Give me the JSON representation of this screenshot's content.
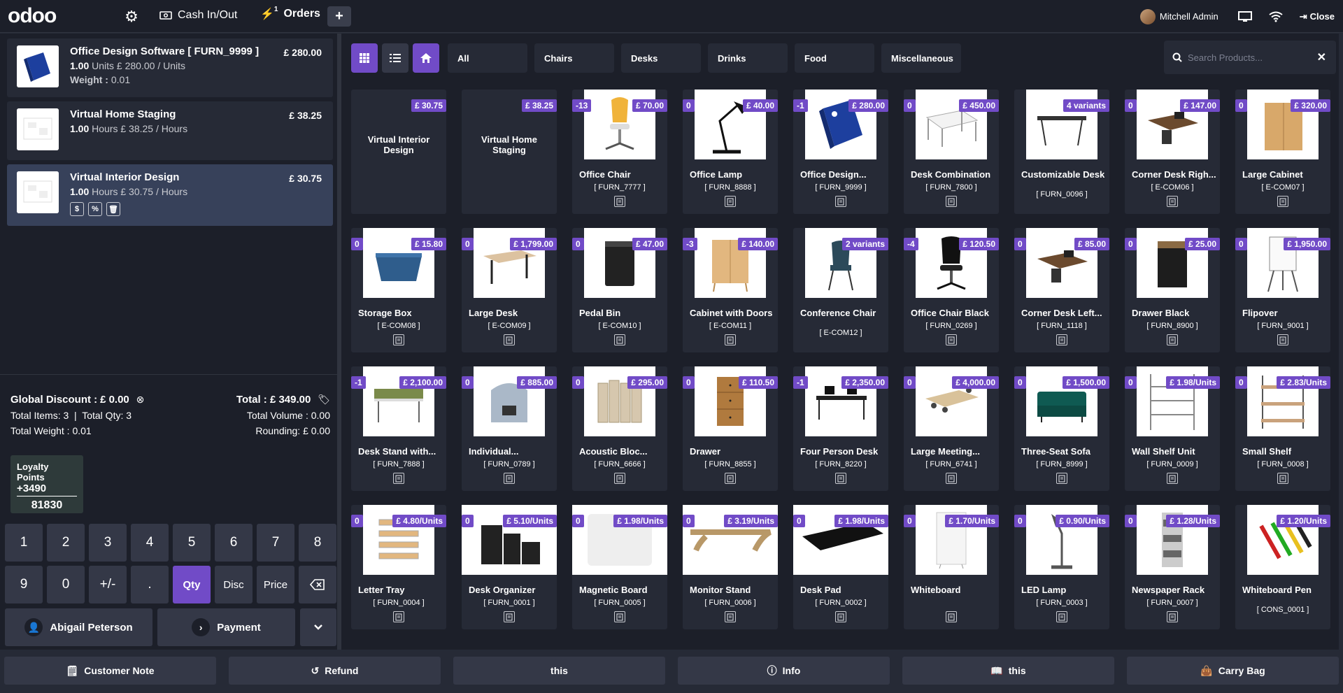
{
  "topbar": {
    "logo": "odoo",
    "cash_label": "Cash In/Out",
    "orders_label": "Orders",
    "orders_count": "1",
    "user_name": "Mitchell Admin",
    "close_label": "Close"
  },
  "orderlines": [
    {
      "name": "Office Design Software [ FURN_9999 ]",
      "qty": "1.00",
      "detail": "Units £ 280.00 / Units",
      "weight_label": "Weight :",
      "weight_value": "0.01",
      "price": "£ 280.00",
      "selected": false
    },
    {
      "name": "Virtual Home Staging",
      "qty": "1.00",
      "detail": "Hours £ 38.25 / Hours",
      "price": "£ 38.25",
      "selected": false
    },
    {
      "name": "Virtual Interior Design",
      "qty": "1.00",
      "detail": "Hours £ 30.75 / Hours",
      "price": "£ 30.75",
      "selected": true
    }
  ],
  "summary": {
    "global_discount_label": "Global Discount :",
    "global_discount_value": "£ 0.00",
    "total_items": "Total Items: 3",
    "total_qty": "Total Qty: 3",
    "total_weight": "Total Weight : 0.01",
    "total": "Total : £ 349.00",
    "total_volume": "Total Volume : 0.00",
    "rounding": "Rounding: £ 0.00"
  },
  "loyalty": {
    "title": "Loyalty Points",
    "delta": "+3490",
    "balance": "81830"
  },
  "numpad": {
    "row1": [
      "1",
      "2",
      "3",
      "4",
      "5",
      "6",
      "7",
      "8"
    ],
    "row2": [
      "9",
      "0",
      "+/-",
      "."
    ],
    "qty": "Qty",
    "disc": "Disc",
    "price": "Price"
  },
  "actions": {
    "customer": "Abigail Peterson",
    "payment": "Payment"
  },
  "categories": [
    "All",
    "Chairs",
    "Desks",
    "Drinks",
    "Food",
    "Miscellaneous"
  ],
  "search": {
    "placeholder": "Search Products..."
  },
  "products": [
    {
      "name": "Virtual Interior Design",
      "ref": "",
      "qty": "",
      "price": "£ 30.75",
      "type": "text"
    },
    {
      "name": "Virtual Home Staging",
      "ref": "",
      "qty": "",
      "price": "£ 38.25",
      "type": "text"
    },
    {
      "name": "Office Chair",
      "ref": "[ FURN_7777 ]",
      "qty": "-13",
      "price": "£ 70.00",
      "img": "chair"
    },
    {
      "name": "Office Lamp",
      "ref": "[ FURN_8888 ]",
      "qty": "0",
      "price": "£ 40.00",
      "img": "lamp"
    },
    {
      "name": "Office Design...",
      "ref": "[ FURN_9999 ]",
      "qty": "-1",
      "price": "£ 280.00",
      "img": "box"
    },
    {
      "name": "Desk Combination",
      "ref": "[ FURN_7800 ]",
      "qty": "0",
      "price": "£ 450.00",
      "img": "desk"
    },
    {
      "name": "Customizable Desk",
      "ref": "[ FURN_0096 ]",
      "qty": "",
      "price": "4 variants",
      "img": "desk2",
      "lowref": true
    },
    {
      "name": "Corner Desk Righ...",
      "ref": "[ E-COM06 ]",
      "qty": "0",
      "price": "£ 147.00",
      "img": "corner"
    },
    {
      "name": "Large Cabinet",
      "ref": "[ E-COM07 ]",
      "qty": "0",
      "price": "£ 320.00",
      "img": "cabinet"
    },
    {
      "name": "Storage Box",
      "ref": "[ E-COM08 ]",
      "qty": "0",
      "price": "£ 15.80",
      "img": "basket"
    },
    {
      "name": "Large Desk",
      "ref": "[ E-COM09 ]",
      "qty": "0",
      "price": "£ 1,799.00",
      "img": "desk3"
    },
    {
      "name": "Pedal Bin",
      "ref": "[ E-COM10 ]",
      "qty": "0",
      "price": "£ 47.00",
      "img": "bin"
    },
    {
      "name": "Cabinet with Doors",
      "ref": "[ E-COM11 ]",
      "qty": "-3",
      "price": "£ 140.00",
      "img": "cabinet2"
    },
    {
      "name": "Conference Chair",
      "ref": "[ E-COM12 ]",
      "qty": "",
      "price": "2 variants",
      "img": "confchair",
      "lowref": true
    },
    {
      "name": "Office Chair Black",
      "ref": "[ FURN_0269 ]",
      "qty": "-4",
      "price": "£ 120.50",
      "img": "chairblack"
    },
    {
      "name": "Corner Desk Left...",
      "ref": "[ FURN_1118 ]",
      "qty": "0",
      "price": "£ 85.00",
      "img": "corner"
    },
    {
      "name": "Drawer Black",
      "ref": "[ FURN_8900 ]",
      "qty": "0",
      "price": "£ 25.00",
      "img": "drawerblack"
    },
    {
      "name": "Flipover",
      "ref": "[ FURN_9001 ]",
      "qty": "0",
      "price": "£ 1,950.00",
      "img": "flip"
    },
    {
      "name": "Desk Stand with...",
      "ref": "[ FURN_7888 ]",
      "qty": "-1",
      "price": "£ 2,100.00",
      "img": "deskstand"
    },
    {
      "name": "Individual...",
      "ref": "[ FURN_0789 ]",
      "qty": "0",
      "price": "£ 885.00",
      "img": "pod"
    },
    {
      "name": "Acoustic Bloc...",
      "ref": "[ FURN_6666 ]",
      "qty": "0",
      "price": "£ 295.00",
      "img": "acoustic"
    },
    {
      "name": "Drawer",
      "ref": "[ FURN_8855 ]",
      "qty": "0",
      "price": "£ 110.50",
      "img": "drawer"
    },
    {
      "name": "Four Person Desk",
      "ref": "[ FURN_8220 ]",
      "qty": "-1",
      "price": "£ 2,350.00",
      "img": "fourdesk"
    },
    {
      "name": "Large Meeting...",
      "ref": "[ FURN_6741 ]",
      "qty": "0",
      "price": "£ 4,000.00",
      "img": "meeting"
    },
    {
      "name": "Three-Seat Sofa",
      "ref": "[ FURN_8999 ]",
      "qty": "0",
      "price": "£ 1,500.00",
      "img": "sofa"
    },
    {
      "name": "Wall Shelf Unit",
      "ref": "[ FURN_0009 ]",
      "qty": "0",
      "price": "£ 1.98/Units",
      "img": "shelf"
    },
    {
      "name": "Small Shelf",
      "ref": "[ FURN_0008 ]",
      "qty": "0",
      "price": "£ 2.83/Units",
      "img": "smallshelf"
    },
    {
      "name": "Letter Tray",
      "ref": "[ FURN_0004 ]",
      "qty": "0",
      "price": "£ 4.80/Units",
      "img": "tray"
    },
    {
      "name": "Desk Organizer",
      "ref": "[ FURN_0001 ]",
      "qty": "0",
      "price": "£ 5.10/Units",
      "img": "organizer",
      "wide": true
    },
    {
      "name": "Magnetic Board",
      "ref": "[ FURN_0005 ]",
      "qty": "0",
      "price": "£ 1.98/Units",
      "img": "board",
      "wide": true
    },
    {
      "name": "Monitor Stand",
      "ref": "[ FURN_0006 ]",
      "qty": "0",
      "price": "£ 3.19/Units",
      "img": "stand",
      "wide": true
    },
    {
      "name": "Desk Pad",
      "ref": "[ FURN_0002 ]",
      "qty": "0",
      "price": "£ 1.98/Units",
      "img": "pad",
      "wide": true
    },
    {
      "name": "Whiteboard",
      "ref": "",
      "qty": "0",
      "price": "£ 1.70/Units",
      "img": "whiteboard"
    },
    {
      "name": "LED Lamp",
      "ref": "[ FURN_0003 ]",
      "qty": "0",
      "price": "£ 0.90/Units",
      "img": "ledlamp"
    },
    {
      "name": "Newspaper Rack",
      "ref": "[ FURN_0007 ]",
      "qty": "0",
      "price": "£ 1.28/Units",
      "img": "rack"
    },
    {
      "name": "Whiteboard Pen",
      "ref": "[ CONS_0001 ]",
      "qty": "",
      "price": "£ 1.20/Units",
      "img": "pens",
      "lowref": true
    }
  ],
  "bottom": [
    "Customer Note",
    "Refund",
    "this",
    "Info",
    "this",
    "Carry Bag"
  ],
  "colors": {
    "accent": "#714bc7",
    "bg": "#1c1f29",
    "card": "#262a36"
  }
}
